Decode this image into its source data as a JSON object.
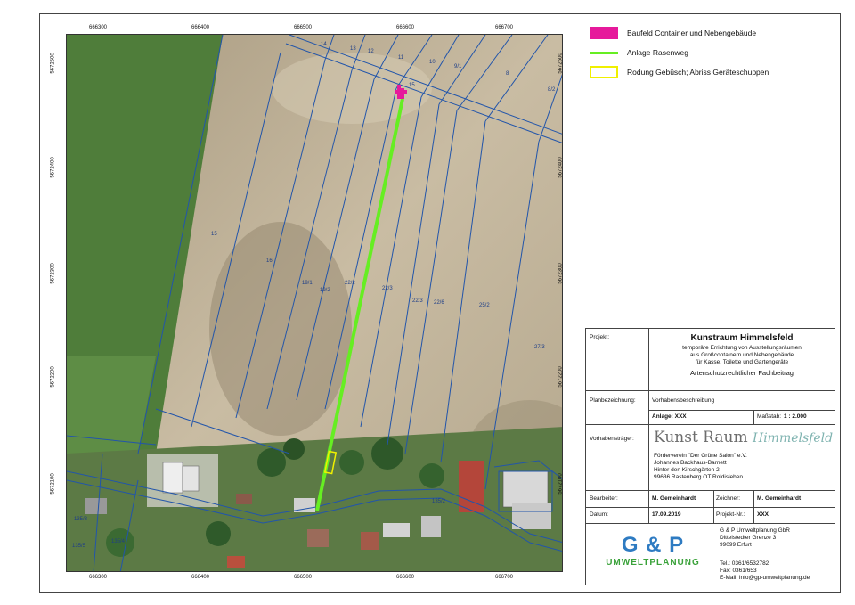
{
  "map": {
    "x_ticks": [
      "666300",
      "666400",
      "666500",
      "666600",
      "666700"
    ],
    "y_ticks": [
      "5672500",
      "5672400",
      "5672300",
      "5672200",
      "5672100"
    ],
    "parcel_labels": [
      "14",
      "13",
      "12",
      "11",
      "10",
      "9/1",
      "8",
      "8/2",
      "15",
      "15",
      "16",
      "19/1",
      "19/2",
      "22/2",
      "22/3",
      "22/3",
      "22/6",
      "25/2",
      "27/3",
      "135/2",
      "135/3",
      "135/4",
      "135/5"
    ]
  },
  "legend": [
    {
      "label": "Baufeld Container und Nebengebäude",
      "color": "#e6199b",
      "kind": "fill",
      "icon": "magenta-rectangle-icon"
    },
    {
      "label": "Anlage Rasenweg",
      "color": "#66ee22",
      "kind": "line",
      "icon": "green-line-icon"
    },
    {
      "label": "Rodung Gebüsch; Abriss Geräteschuppen",
      "color": "#f0f000",
      "kind": "outline",
      "icon": "yellow-outline-icon"
    }
  ],
  "titleblock": {
    "projekt_label": "Projekt:",
    "projekt_title": "Kunstraum Himmelsfeld",
    "projekt_desc_1": "temporäre Errichtung von Ausstellungsräumen",
    "projekt_desc_2": "aus Großcontainern und Nebengebäude",
    "projekt_desc_3": "für Kasse, Toilette und Gartengeräte",
    "projekt_sub": "Artenschutzrechtlicher Fachbeitrag",
    "plan_label": "Planbezeichnung:",
    "plan_value": "Vorhabensbeschreibung",
    "anlage": "Anlage: XXX",
    "massstab_label": "Maßstab:",
    "massstab_value": "1 : 2.000",
    "traeger_label": "Vorhabensträger:",
    "brand_main": "Kunst Raum",
    "brand_script": "Himmelsfeld",
    "traeger_1": "Förderverein \"Der Grüne Salon\" e.V.",
    "traeger_2": "Johannes Backhaus-Barnett",
    "traeger_3": "Hinter den Kirschgärten 2",
    "traeger_4": "99636 Rastenberg OT Roldisleben",
    "bearbeiter_label": "Bearbeiter:",
    "bearbeiter_value": "M. Gemeinhardt",
    "zeichner_label": "Zeichner:",
    "zeichner_value": "M. Gemeinhardt",
    "datum_label": "Datum:",
    "datum_value": "17.09.2019",
    "projektnr_label": "Projekt-Nr.:",
    "projektnr_value": "XXX",
    "logo_big": "G & P",
    "logo_small": "UMWELTPLANUNG",
    "firm_1": "G & P Umweltplanung GbR",
    "firm_2": "Dittelstedter Grenze 3",
    "firm_3": "99099 Erfurt",
    "tel": "Tel.: 0361/6532782",
    "fax": "Fax: 0361/653",
    "email": "E-Mail: info@gp-umweltplanung.de"
  }
}
